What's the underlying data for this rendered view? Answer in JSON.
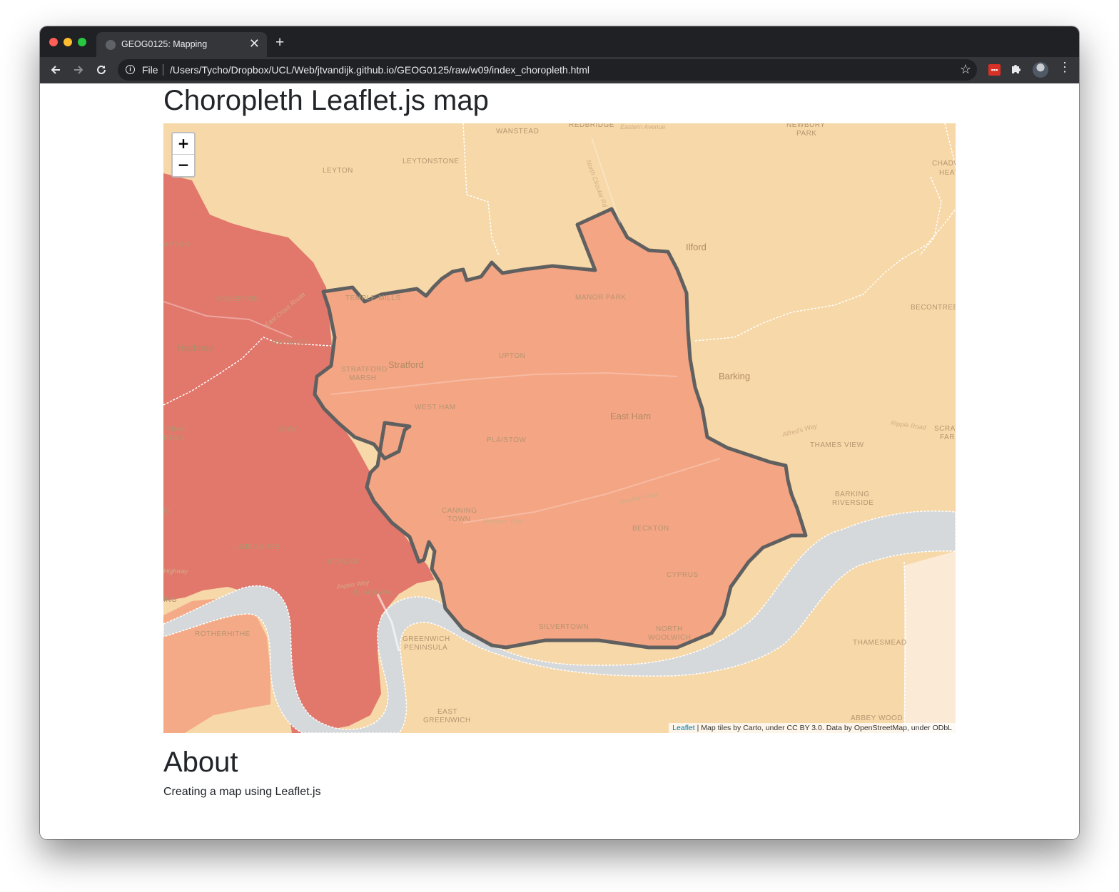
{
  "browser": {
    "tab_title": "GEOG0125: Mapping",
    "new_tab_label": "+",
    "close_tab_label": "✕",
    "scheme_label": "File",
    "url": "/Users/Tycho/Dropbox/UCL/Web/jtvandijk.github.io/GEOG0125/raw/w09/index_choropleth.html",
    "extension_label": "▪▪▪"
  },
  "page": {
    "title": "Choropleth Leaflet.js map",
    "about_heading": "About",
    "about_text": "Creating a map using Leaflet.js"
  },
  "map": {
    "zoom_in_label": "+",
    "zoom_out_label": "−",
    "attribution_link": "Leaflet",
    "attribution_text": " | Map tiles by Carto, under CC BY 3.0. Data by OpenStreetMap, under ODbL",
    "colors": {
      "base": "#f7d8a8",
      "dark_borough": "#e2776c",
      "selected_borough": "#f4a584",
      "light_borough": "#f5aa87",
      "outline": "#606060",
      "river": "#d5d9db",
      "pale_area": "#fbebd6"
    },
    "place_labels": {
      "wanstead": "WANSTEAD",
      "redbridge": "REDBRIDGE",
      "newbury_park": "NEWBURY",
      "newbury_park2": "PARK",
      "leyton": "LEYTON",
      "leytonstone": "LEYTONSTONE",
      "chadwell": "CHADWE",
      "chadwell2": "HEATH",
      "clapton": "APTON",
      "ilford": "Ilford",
      "homerton": "HOMERTON",
      "temple_mills": "TEMPLE MILLS",
      "manor_park": "MANOR PARK",
      "becontree": "BECONTREE",
      "hackney": "Hackney",
      "hackney_small": "HACKNEY",
      "upton": "UPTON",
      "stratford_marsh": "STRATFORD",
      "stratford_marsh2": "MARSH",
      "stratford": "Stratford",
      "barking": "Barking",
      "west_ham": "WEST HAM",
      "east_ham": "East Ham",
      "bethnal": "THNAL",
      "bethnal2": "REEN",
      "bow": "BOW",
      "plaistow": "PLAISTOW",
      "thames_view": "THAMES VIEW",
      "scrat": "SCRAT",
      "scrat2": "FAR",
      "barking_riverside": "BARKING",
      "barking_riverside2": "RIVERSIDE",
      "el": "EL",
      "canning_town": "CANNING",
      "canning_town2": "TOWN",
      "beckton": "BECKTON",
      "limehouse": "LIMEHOUSE",
      "poplar": "POPLAR",
      "cyprus": "CYPRUS",
      "blackwall": "BLACKWALL",
      "ing": "ING",
      "silvertown": "SILVERTOWN",
      "north_woolwich": "NORTH",
      "north_woolwich2": "WOOLWICH",
      "rotherhithe": "ROTHERHITHE",
      "greenwich_peninsula": "GREENWICH",
      "greenwich_peninsula2": "PENINSULA",
      "thamesmead": "THAMESMEAD",
      "east_greenwich": "EAST",
      "east_greenwich2": "GREENWICH",
      "abbey_wood": "ABBEY WOOD"
    },
    "road_labels": {
      "eastern_avenue": "Eastern Avenue",
      "north_circular": "North Circular Rd",
      "east_cross": "East Cross Route",
      "newham_way": "Newham Way",
      "newham_way2": "Newham Way",
      "alfreds_way": "Alfred's Way",
      "ripple_road": "Ripple Road",
      "highway": "Highway",
      "aspen_way": "Aspen Way"
    }
  }
}
